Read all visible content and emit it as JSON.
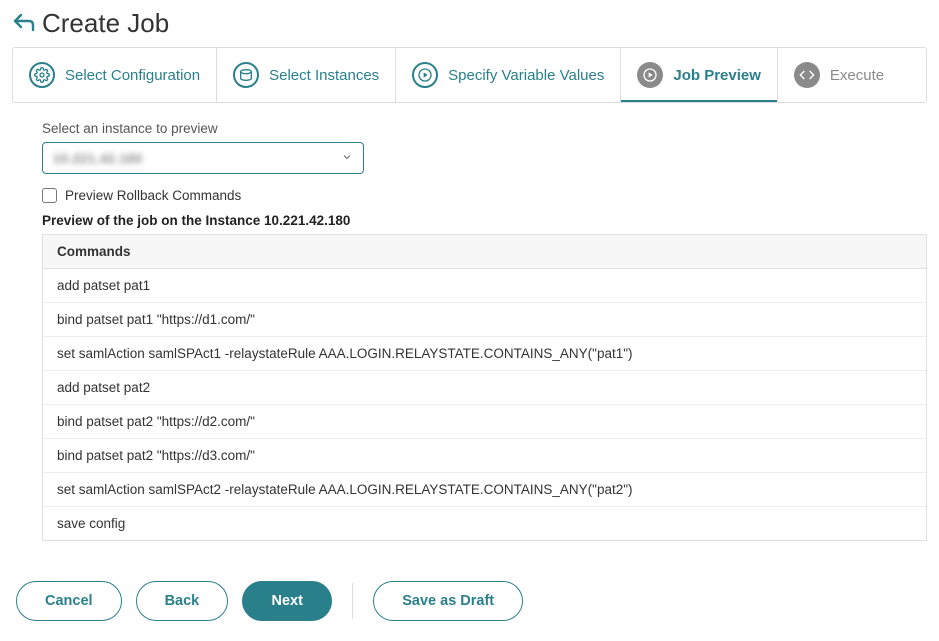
{
  "header": {
    "title": "Create Job"
  },
  "tabs": [
    {
      "id": "config",
      "label": "Select Configuration",
      "style": "ring",
      "icon": "gear",
      "active": false
    },
    {
      "id": "instances",
      "label": "Select Instances",
      "style": "ring",
      "icon": "disk",
      "active": false
    },
    {
      "id": "vars",
      "label": "Specify Variable Values",
      "style": "ring",
      "icon": "play",
      "active": false
    },
    {
      "id": "preview",
      "label": "Job Preview",
      "style": "solid",
      "icon": "play",
      "active": true
    },
    {
      "id": "execute",
      "label": "Execute",
      "style": "solid",
      "icon": "code",
      "active": false,
      "disabled": true
    }
  ],
  "instance_select": {
    "label": "Select an instance to preview",
    "value": "10.221.42.180"
  },
  "rollback_checkbox": {
    "label": "Preview Rollback Commands",
    "checked": false
  },
  "preview": {
    "label": "Preview of the job on the Instance 10.221.42.180",
    "columns": [
      "Commands"
    ],
    "rows": [
      "add patset pat1",
      "bind patset pat1 \"https://d1.com/\"",
      "set samlAction samlSPAct1 -relaystateRule AAA.LOGIN.RELAYSTATE.CONTAINS_ANY(\"pat1\")",
      "add patset pat2",
      "bind patset pat2 \"https://d2.com/\"",
      "bind patset pat2 \"https://d3.com/\"",
      "set samlAction samlSPAct2 -relaystateRule AAA.LOGIN.RELAYSTATE.CONTAINS_ANY(\"pat2\")",
      "save config"
    ]
  },
  "footer": {
    "cancel": "Cancel",
    "back": "Back",
    "next": "Next",
    "save_draft": "Save as Draft"
  }
}
